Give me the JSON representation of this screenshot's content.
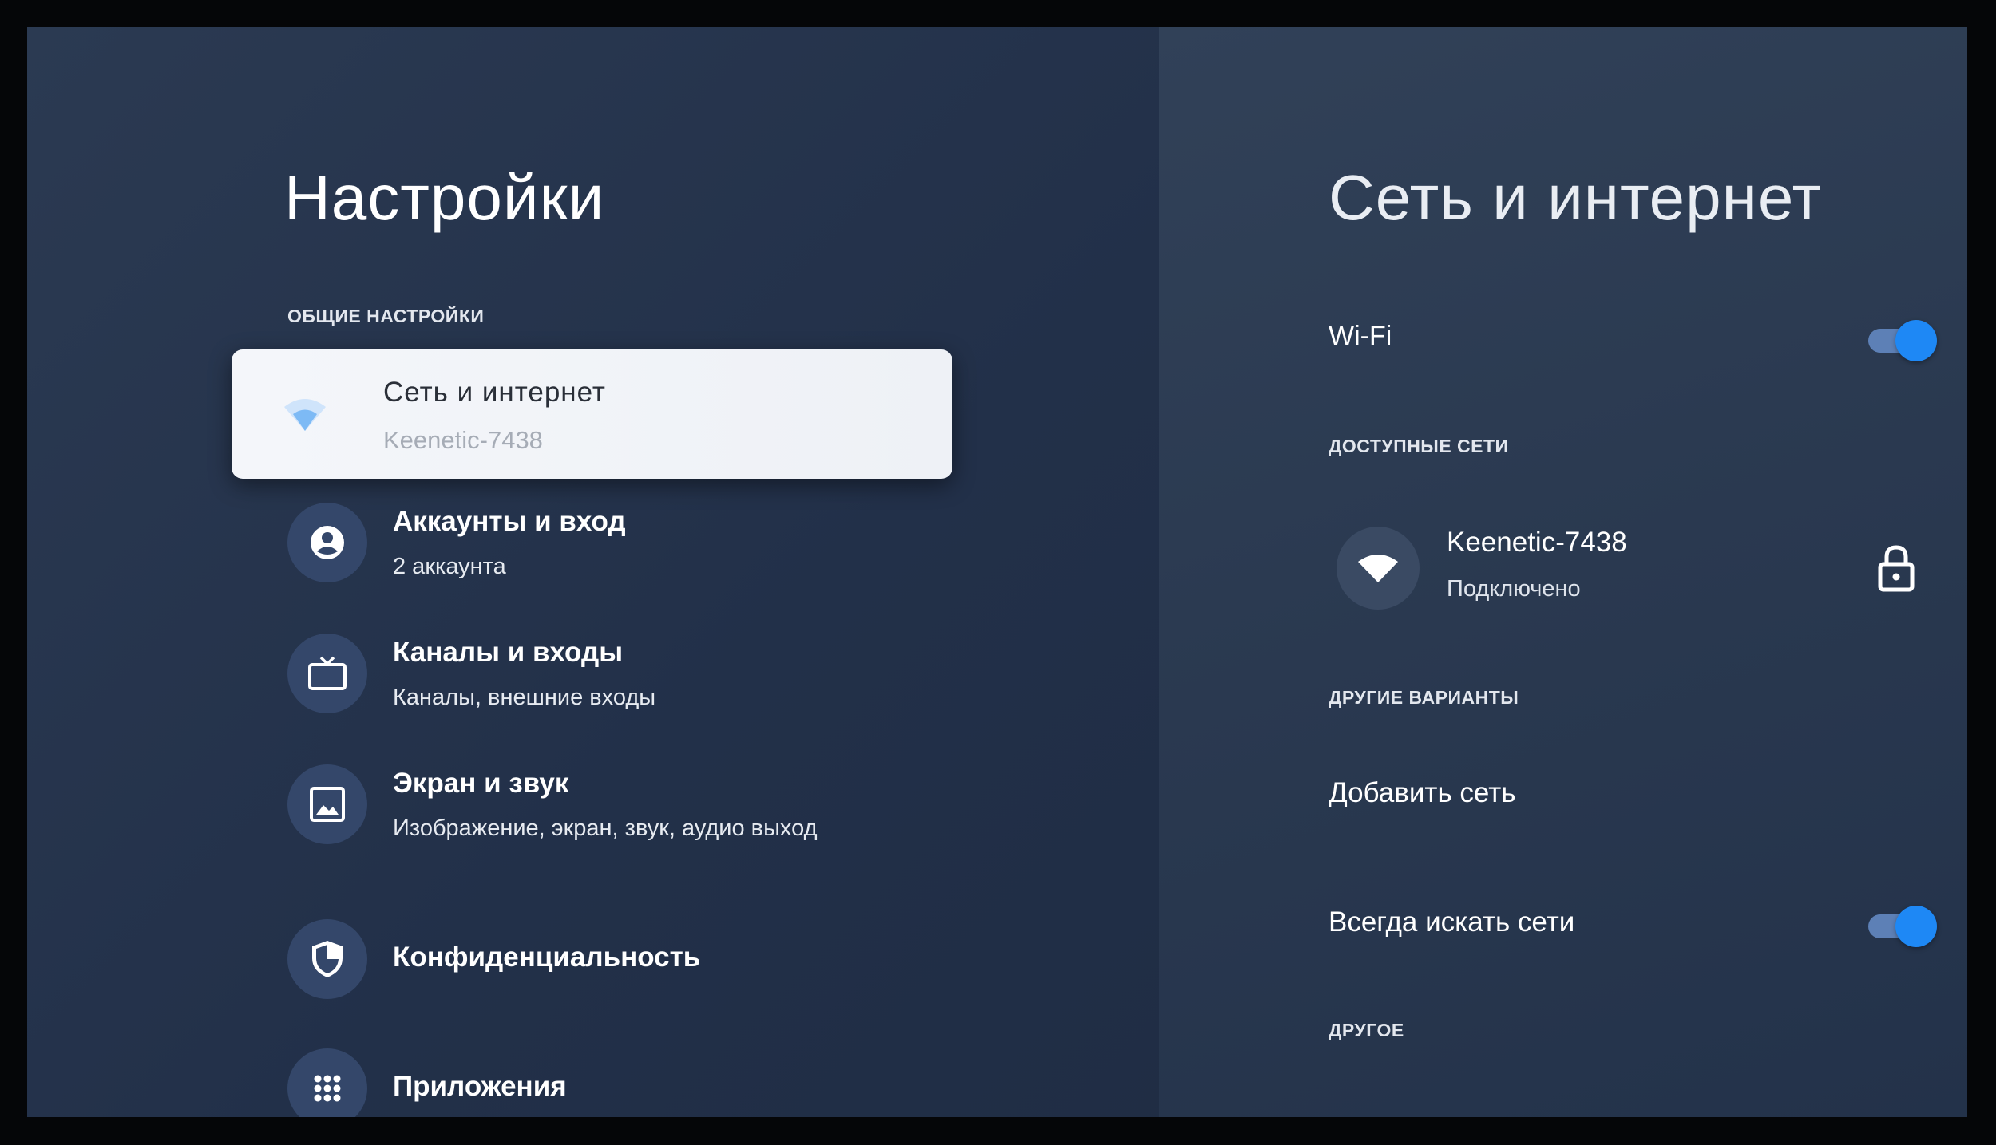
{
  "settings": {
    "title": "Настройки",
    "section_general": "ОБЩИЕ НАСТРОЙКИ",
    "items": [
      {
        "label": "Сеть и интернет",
        "sub": "Keenetic-7438",
        "icon": "wifi-icon",
        "selected": true
      },
      {
        "label": "Аккаунты и вход",
        "sub": "2 аккаунта",
        "icon": "account-icon"
      },
      {
        "label": "Каналы и входы",
        "sub": "Каналы, внешние входы",
        "icon": "tv-icon"
      },
      {
        "label": "Экран и звук",
        "sub": "Изображение, экран, звук, аудио выход",
        "icon": "image-icon"
      },
      {
        "label": "Конфиденциальность",
        "sub": "",
        "icon": "shield-icon"
      },
      {
        "label": "Приложения",
        "sub": "",
        "icon": "apps-grid-icon"
      }
    ]
  },
  "network": {
    "title": "Сеть и интернет",
    "wifi_label": "Wi-Fi",
    "wifi_enabled": true,
    "section_available": "ДОСТУПНЫЕ СЕТИ",
    "current_network": {
      "name": "Keenetic-7438",
      "status": "Подключено",
      "secured": true
    },
    "section_other_options": "ДРУГИЕ ВАРИАНТЫ",
    "add_network": "Добавить сеть",
    "always_scan_label": "Всегда искать сети",
    "always_scan_enabled": true,
    "section_other": "ДРУГОЕ"
  },
  "colors": {
    "accent": "#1e88f5",
    "toggle_track": "#5d80b6",
    "icon_circle": "#34476a",
    "selected_card": "#f4f6fa"
  }
}
